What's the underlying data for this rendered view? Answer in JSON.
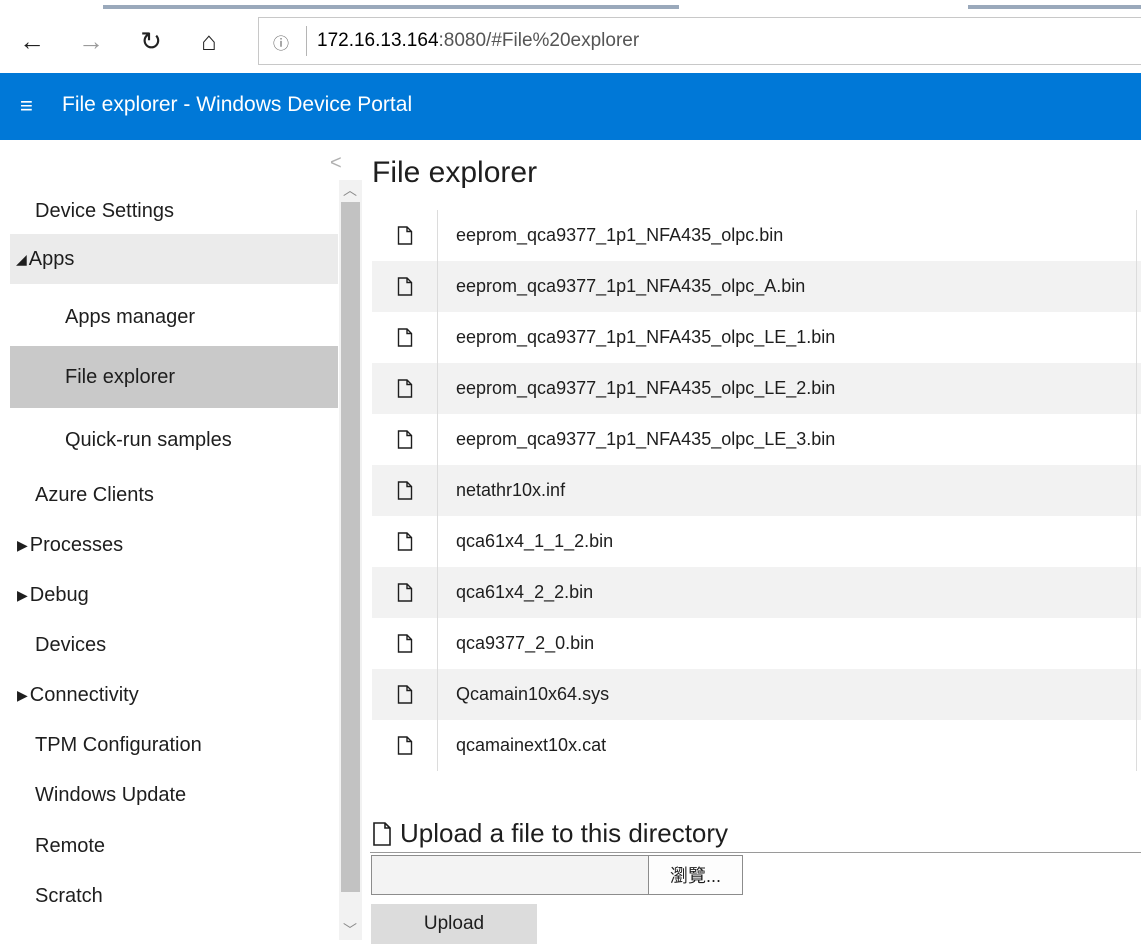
{
  "browser": {
    "back_glyph": "←",
    "forward_glyph": "→",
    "refresh_glyph": "↻",
    "home_glyph": "⌂",
    "info_glyph": "ⓘ",
    "url_host": "172.16.13.164",
    "url_rest": ":8080/#File%20explorer"
  },
  "header": {
    "menu_glyph": "≡",
    "title": "File explorer - Windows Device Portal",
    "color": "#0078d7"
  },
  "sidebar": {
    "collapse_glyph": "<",
    "items": [
      {
        "label": "Device Settings",
        "expander": ""
      },
      {
        "label": "Apps",
        "expander": "◢"
      },
      {
        "label": "Apps manager",
        "expander": ""
      },
      {
        "label": "File explorer",
        "expander": ""
      },
      {
        "label": "Quick-run samples",
        "expander": ""
      },
      {
        "label": "Azure Clients",
        "expander": ""
      },
      {
        "label": "Processes",
        "expander": "▶"
      },
      {
        "label": "Debug",
        "expander": "▶"
      },
      {
        "label": "Devices",
        "expander": ""
      },
      {
        "label": "Connectivity",
        "expander": "▶"
      },
      {
        "label": "TPM Configuration",
        "expander": ""
      },
      {
        "label": "Windows Update",
        "expander": ""
      },
      {
        "label": "Remote",
        "expander": ""
      },
      {
        "label": "Scratch",
        "expander": ""
      }
    ],
    "active": "File explorer"
  },
  "main": {
    "title": "File explorer",
    "files": [
      "eeprom_qca9377_1p1_NFA435_olpc.bin",
      "eeprom_qca9377_1p1_NFA435_olpc_A.bin",
      "eeprom_qca9377_1p1_NFA435_olpc_LE_1.bin",
      "eeprom_qca9377_1p1_NFA435_olpc_LE_2.bin",
      "eeprom_qca9377_1p1_NFA435_olpc_LE_3.bin",
      "netathr10x.inf",
      "qca61x4_1_1_2.bin",
      "qca61x4_2_2.bin",
      "qca9377_2_0.bin",
      "Qcamain10x64.sys",
      "qcamainext10x.cat"
    ],
    "upload": {
      "heading": "Upload a file to this directory",
      "file_value": "",
      "browse_label": "瀏覽...",
      "upload_label": "Upload"
    }
  }
}
